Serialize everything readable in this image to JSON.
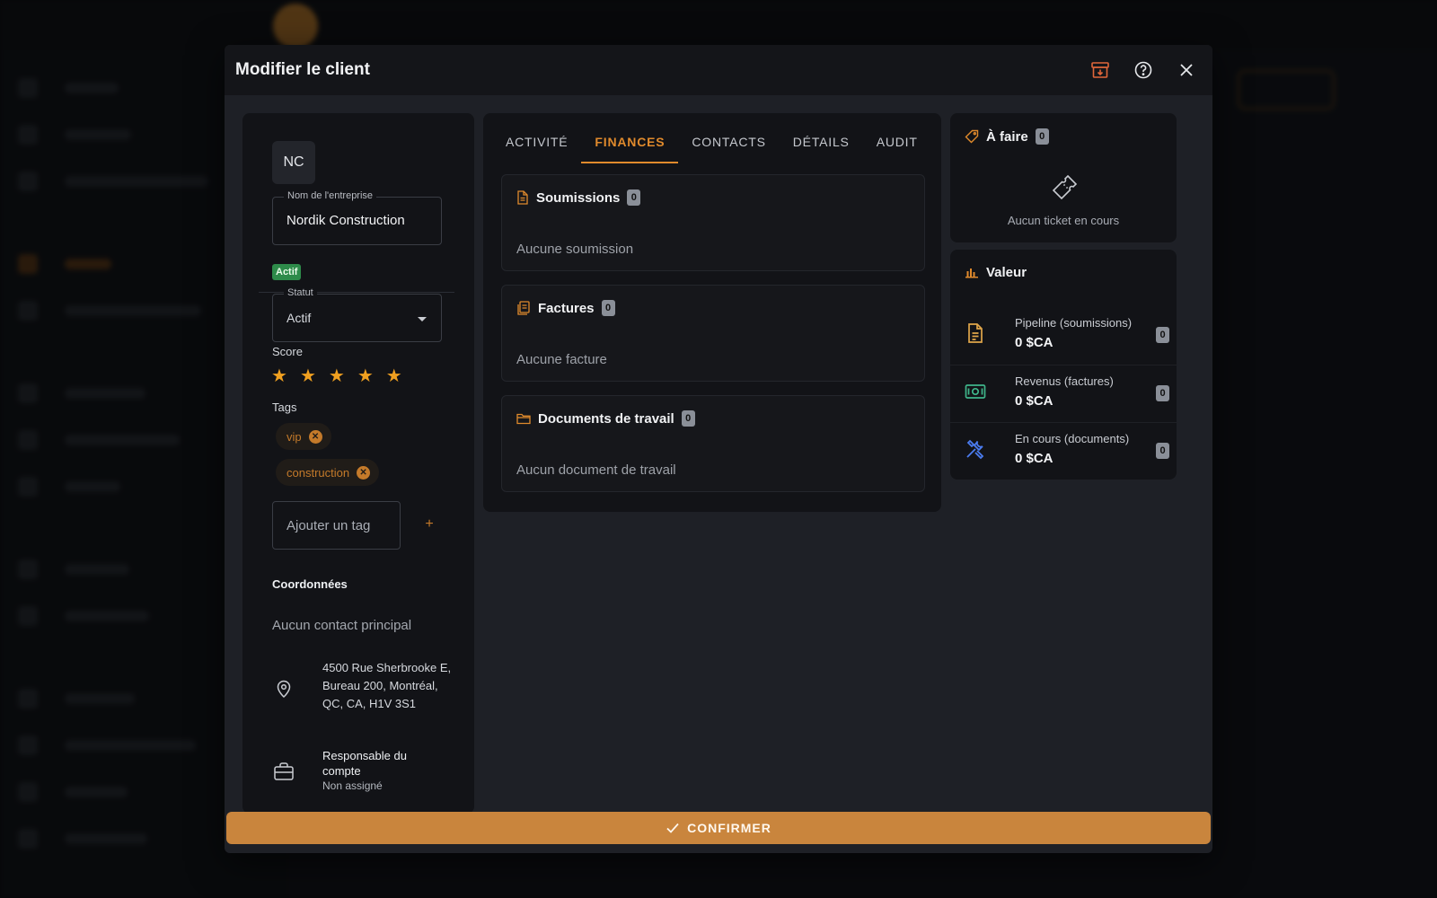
{
  "modal": {
    "title": "Modifier le client"
  },
  "client": {
    "initials": "NC",
    "company_label": "Nom de l'entreprise",
    "company_name": "Nordik Construction",
    "status_badge": "Actif",
    "status_label": "Statut",
    "status_value": "Actif",
    "score_label": "Score",
    "score": 5,
    "score_max": 5,
    "tags_label": "Tags",
    "tags": [
      "vip",
      "construction"
    ],
    "add_tag_placeholder": "Ajouter un tag",
    "add_tag_button": "+",
    "coordinates_title": "Coordonnées",
    "no_primary_contact": "Aucun contact principal",
    "address": "4500 Rue Sherbrooke E, Bureau 200, Montréal, QC, CA, H1V 3S1",
    "account_manager_label": "Responsable du compte",
    "account_manager_value": "Non assigné"
  },
  "tabs": [
    {
      "label": "ACTIVITÉ",
      "active": false
    },
    {
      "label": "FINANCES",
      "active": true
    },
    {
      "label": "CONTACTS",
      "active": false
    },
    {
      "label": "DÉTAILS",
      "active": false
    },
    {
      "label": "AUDIT",
      "active": false
    }
  ],
  "finances": [
    {
      "title": "Soumissions",
      "count": "0",
      "empty": "Aucune soumission",
      "icon": "document-icon"
    },
    {
      "title": "Factures",
      "count": "0",
      "empty": "Aucune facture",
      "icon": "invoice-icon"
    },
    {
      "title": "Documents de travail",
      "count": "0",
      "empty": "Aucun document de travail",
      "icon": "folder-icon"
    }
  ],
  "todo": {
    "title": "À faire",
    "count": "0",
    "empty": "Aucun ticket en cours"
  },
  "value": {
    "title": "Valeur",
    "metrics": [
      {
        "label": "Pipeline (soumissions)",
        "value": "0 $CA",
        "count": "0",
        "icon": "document-icon",
        "color": "#e0a64a"
      },
      {
        "label": "Revenus (factures)",
        "value": "0 $CA",
        "count": "0",
        "icon": "money-icon",
        "color": "#3fb58a"
      },
      {
        "label": "En cours (documents)",
        "value": "0 $CA",
        "count": "0",
        "icon": "tools-icon",
        "color": "#4b7cf0"
      }
    ]
  },
  "footer": {
    "confirm_label": "CONFIRMER"
  },
  "colors": {
    "accent": "#e08a2c",
    "confirm": "#c9853d",
    "success": "#2e8b4a"
  }
}
